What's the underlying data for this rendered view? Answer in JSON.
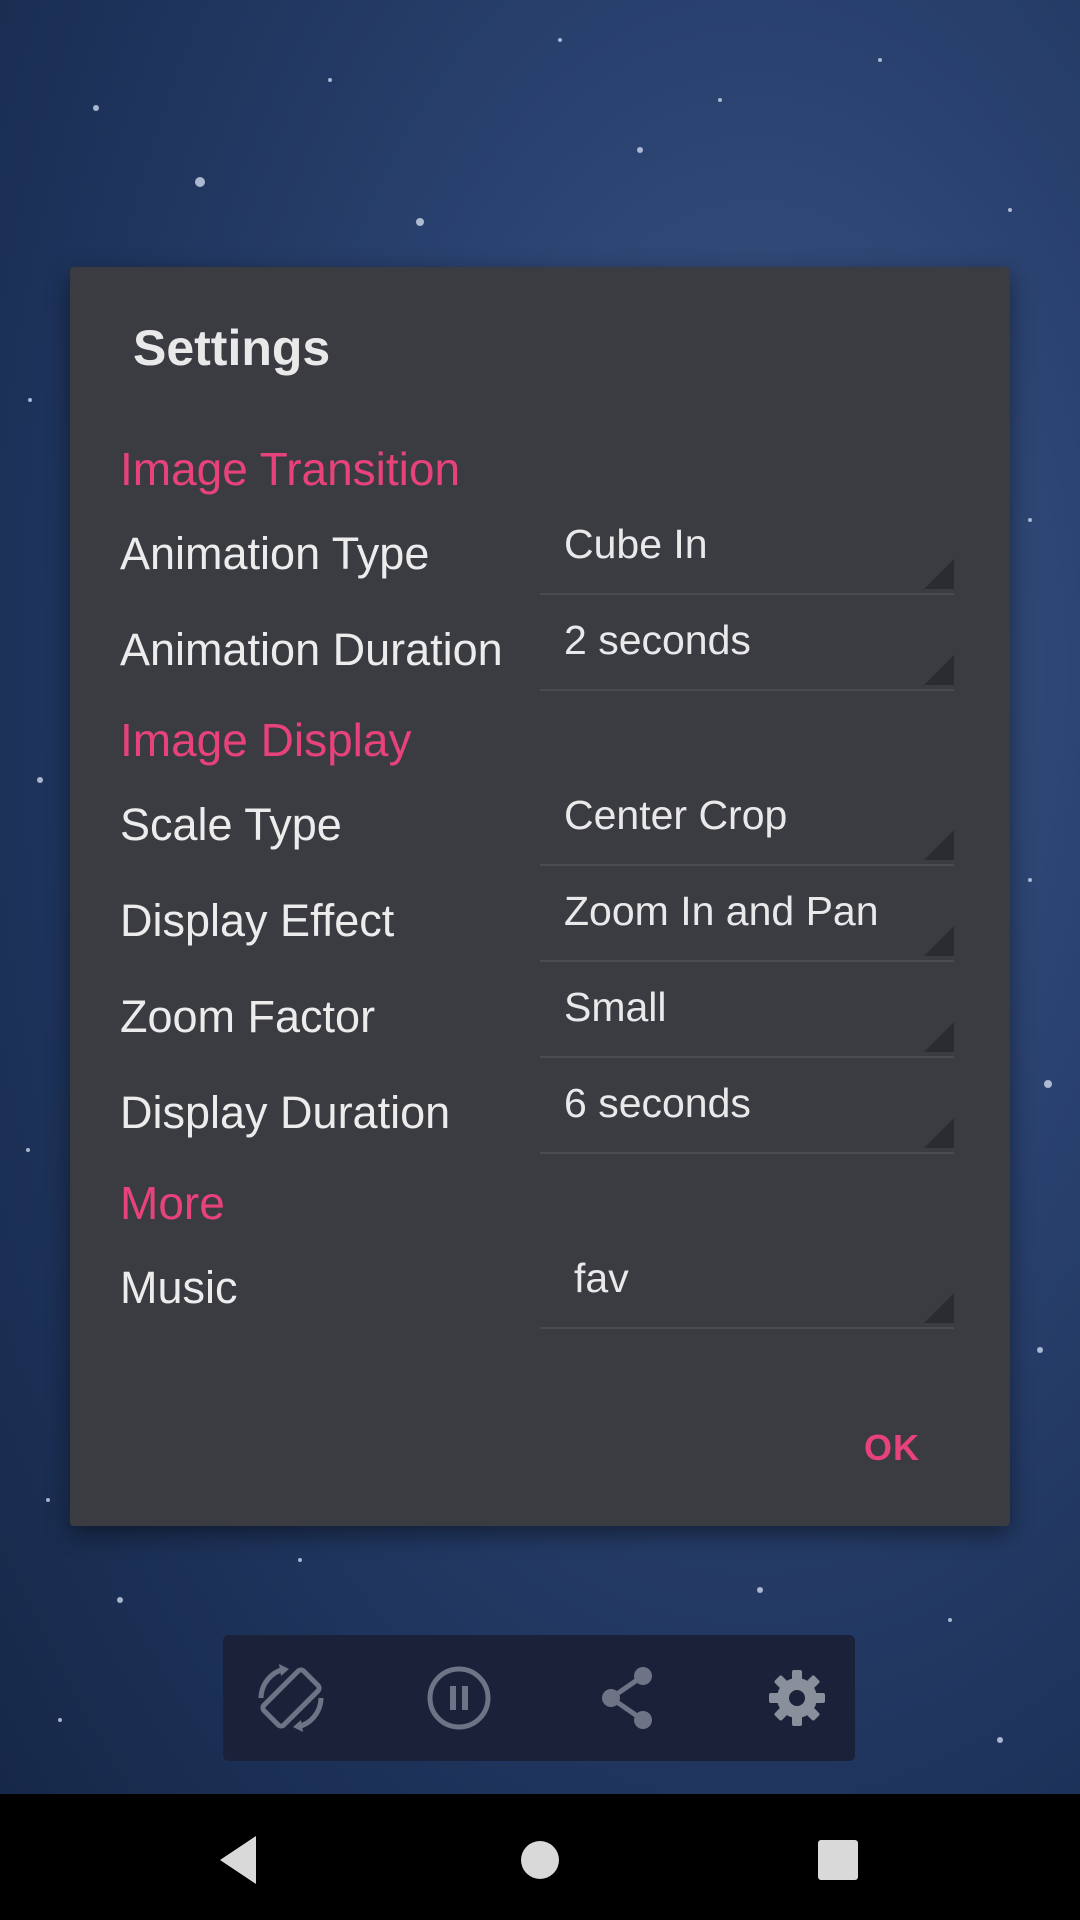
{
  "dialog": {
    "title": "Settings",
    "sections": {
      "transition": "Image Transition",
      "display": "Image Display",
      "more": "More"
    },
    "rows": {
      "animation_type": {
        "label": "Animation Type",
        "value": "Cube In"
      },
      "animation_duration": {
        "label": "Animation Duration",
        "value": "2 seconds"
      },
      "scale_type": {
        "label": "Scale Type",
        "value": "Center Crop"
      },
      "display_effect": {
        "label": "Display Effect",
        "value": "Zoom In and Pan"
      },
      "zoom_factor": {
        "label": "Zoom Factor",
        "value": "Small"
      },
      "display_duration": {
        "label": "Display Duration",
        "value": "6 seconds"
      },
      "music": {
        "label": "Music",
        "value": "fav"
      }
    },
    "ok_label": "OK"
  },
  "toolbar": {
    "icons": [
      "screen-rotation-icon",
      "pause-icon",
      "share-icon",
      "settings-gear-icon"
    ]
  },
  "navbar": {
    "icons": [
      "back-icon",
      "home-icon",
      "recents-icon"
    ]
  },
  "colors": {
    "accent": "#e8427a",
    "dialog_bg": "#3b3c42",
    "toolbar_bg": "#1a2138"
  }
}
